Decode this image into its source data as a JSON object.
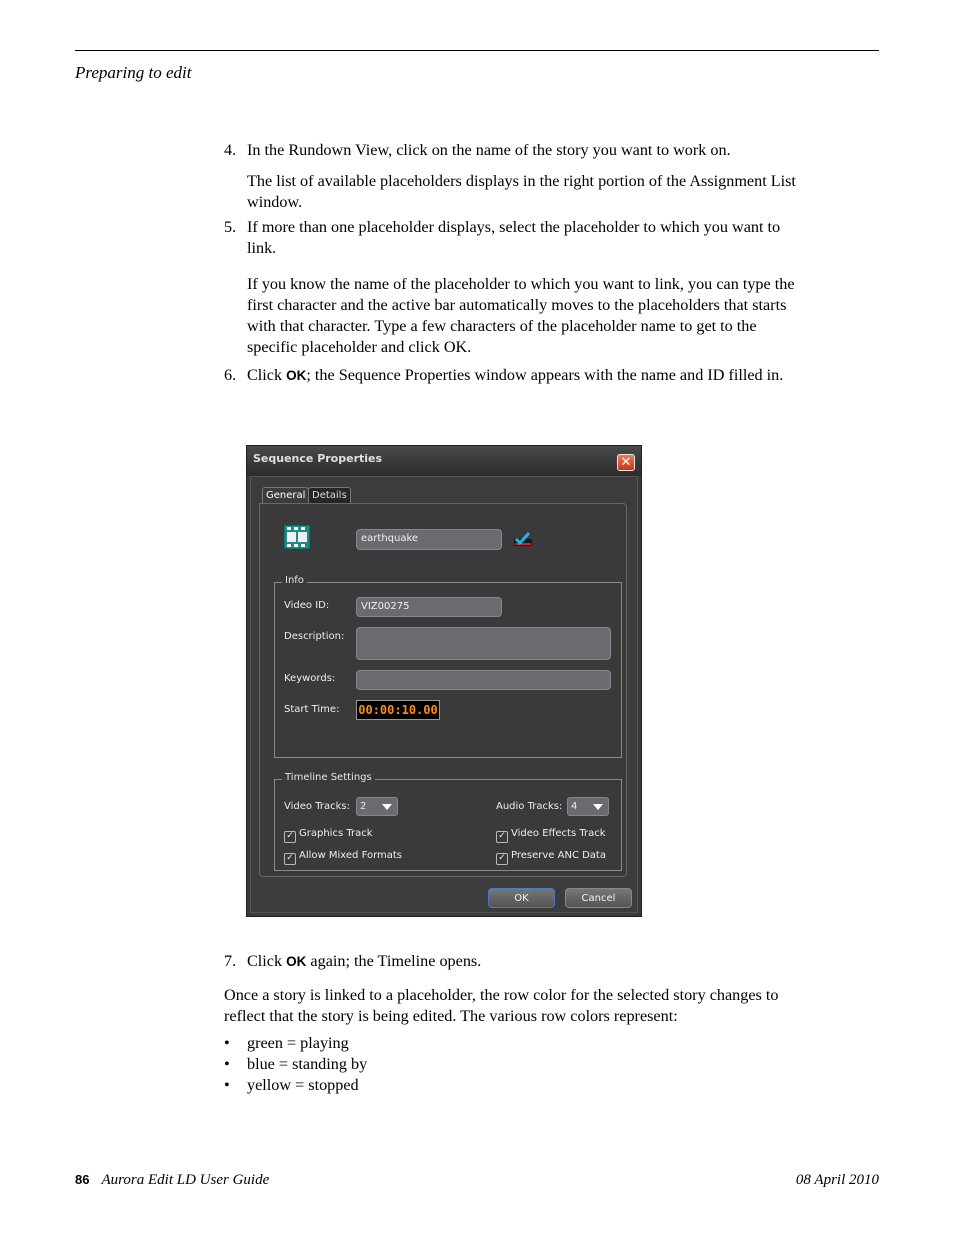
{
  "page": {
    "running_head": "Preparing to edit",
    "footer": {
      "page_number": "86",
      "title": "Aurora Edit LD User Guide",
      "date": "08 April 2010"
    }
  },
  "content": {
    "step4": {
      "num": "4.",
      "text": "In the Rundown View, click on the name of the story you want to work on."
    },
    "step4_note": "The list of available placeholders displays in the right portion of the Assignment List window.",
    "step5": {
      "num": "5.",
      "text": "If more than one placeholder displays, select the placeholder to which you want to link."
    },
    "step5_note": "If you know the name of the placeholder to which you want to link, you can type the first character and the active bar automatically moves to the placeholders that starts with that character. Type a few characters of the placeholder name to get to the specific placeholder and click OK.",
    "step6": {
      "num": "6.",
      "pre": "Click ",
      "ok": "OK",
      "post": "; the Sequence Properties window appears with the name and ID filled in."
    },
    "step7": {
      "num": "7.",
      "pre": "Click ",
      "ok": "OK",
      "post": " again; the Timeline opens."
    },
    "summary": "Once a story is linked to a placeholder, the row color for the selected story changes to reflect that the story is being edited. The various row colors represent:",
    "bullets": [
      {
        "bullet": "•",
        "text": "green = playing"
      },
      {
        "bullet": "•",
        "text": "blue = standing by"
      },
      {
        "bullet": "•",
        "text": "yellow = stopped"
      }
    ]
  },
  "dialog": {
    "title": "Sequence Properties",
    "close_glyph": "✕",
    "tabs": [
      {
        "label": "General",
        "active": true
      },
      {
        "label": "Details",
        "active": false
      }
    ],
    "name_value": "earthquake",
    "icons": {
      "sequence": "film-strip-icon",
      "link": "link-check-icon"
    },
    "info": {
      "legend": "Info",
      "video_id_label": "Video ID:",
      "video_id_value": "VIZ00275",
      "description_label": "Description:",
      "description_value": "",
      "keywords_label": "Keywords:",
      "keywords_value": "",
      "start_time_label": "Start Time:",
      "start_time_value": "00:00:10.00"
    },
    "timeline": {
      "legend": "Timeline Settings",
      "video_tracks_label": "Video Tracks:",
      "video_tracks_value": "2",
      "audio_tracks_label": "Audio Tracks:",
      "audio_tracks_value": "4",
      "checkboxes": [
        {
          "label": "Graphics Track",
          "checked": true
        },
        {
          "label": "Video Effects Track",
          "checked": true
        },
        {
          "label": "Allow Mixed Formats",
          "checked": true
        },
        {
          "label": "Preserve ANC Data",
          "checked": true
        }
      ],
      "check_glyph": "✓"
    },
    "buttons": {
      "ok": "OK",
      "cancel": "Cancel"
    }
  }
}
